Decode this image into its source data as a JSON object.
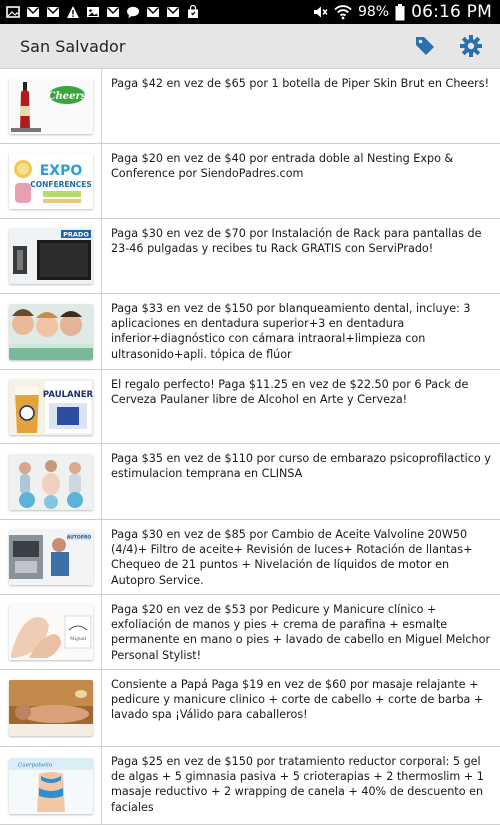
{
  "status_bar": {
    "battery": "98%",
    "time": "06:16 PM",
    "left_icons": [
      "photo-icon",
      "gmail-icon",
      "gmail-icon",
      "warning-icon",
      "gallery-icon",
      "gmail-icon",
      "chat-icon",
      "gmail-icon",
      "gmail-icon",
      "bag-icon"
    ],
    "right_icons": [
      "mute-icon",
      "wifi-icon",
      "battery-icon"
    ]
  },
  "action_bar": {
    "city": "San Salvador",
    "icons": [
      "tag-icon",
      "gear-icon"
    ],
    "accent": "#2a6fb0"
  },
  "deals": [
    {
      "text": "Paga $42 en vez de $65 por 1 botella de Piper Skin Brut en Cheers!",
      "thumb": "cheers-wine-image"
    },
    {
      "text": "Paga $20 en vez de $40 por entrada doble al Nesting Expo & Conference por SiendoPadres.com",
      "thumb": "expo-conferences-image"
    },
    {
      "text": "Paga $30 en vez de $70 por Instalación de Rack para pantallas de 23-46 pulgadas y recibes tu Rack GRATIS con ServiPrado!",
      "thumb": "prado-tv-rack-image"
    },
    {
      "text": "Paga $33 en vez de $150 por blanqueamiento dental, incluye: 3 aplicaciones en dentadura superior+3 en dentadura inferior+diagnóstico con cámara intraoral+limpieza con ultrasonido+apli. tópica de flúor",
      "thumb": "dental-smiles-image"
    },
    {
      "text": "El regalo perfecto! Paga $11.25 en vez de $22.50 por 6 Pack de Cerveza Paulaner libre de Alcohol en Arte y Cerveza!",
      "thumb": "paulaner-beer-image"
    },
    {
      "text": "Paga $35 en vez de $110 por  curso de embarazo psicoprofilactico y estimulacion temprana en CLINSA",
      "thumb": "pregnancy-course-image"
    },
    {
      "text": "Paga $30 en vez de $85 por Cambio de Aceite Valvoline 20W50 (4/4)+ Filtro de aceite+ Revisión de luces+ Rotación de llantas+ Chequeo de 21 puntos + Nivelación de líquidos de motor en Autopro Service.",
      "thumb": "autopro-mechanic-image"
    },
    {
      "text": "Paga $20 en vez de $53 por Pedicure y Manicure clínico + exfoliación de manos y pies + crema de parafina + esmalte permanente en mano o pies + lavado de cabello en Miguel Melchor Personal Stylist!",
      "thumb": "pedicure-feet-image"
    },
    {
      "text": "Consiente a Papá Paga $19 en vez de $60 por masaje relajante + pedicure y manicure clinico + corte de cabello +  corte de barba + lavado spa ¡Válido para caballeros!",
      "thumb": "spa-massage-image"
    },
    {
      "text": "Paga $25 en vez de $150 por tratamiento reductor corporal: 5 gel de algas + 5 gimnasia pasiva + 5 crioterapias + 2 thermoslim + 1 masaje reductivo + 2 wrapping de canela + 40% de descuento en faciales",
      "thumb": "body-treatment-image"
    }
  ]
}
